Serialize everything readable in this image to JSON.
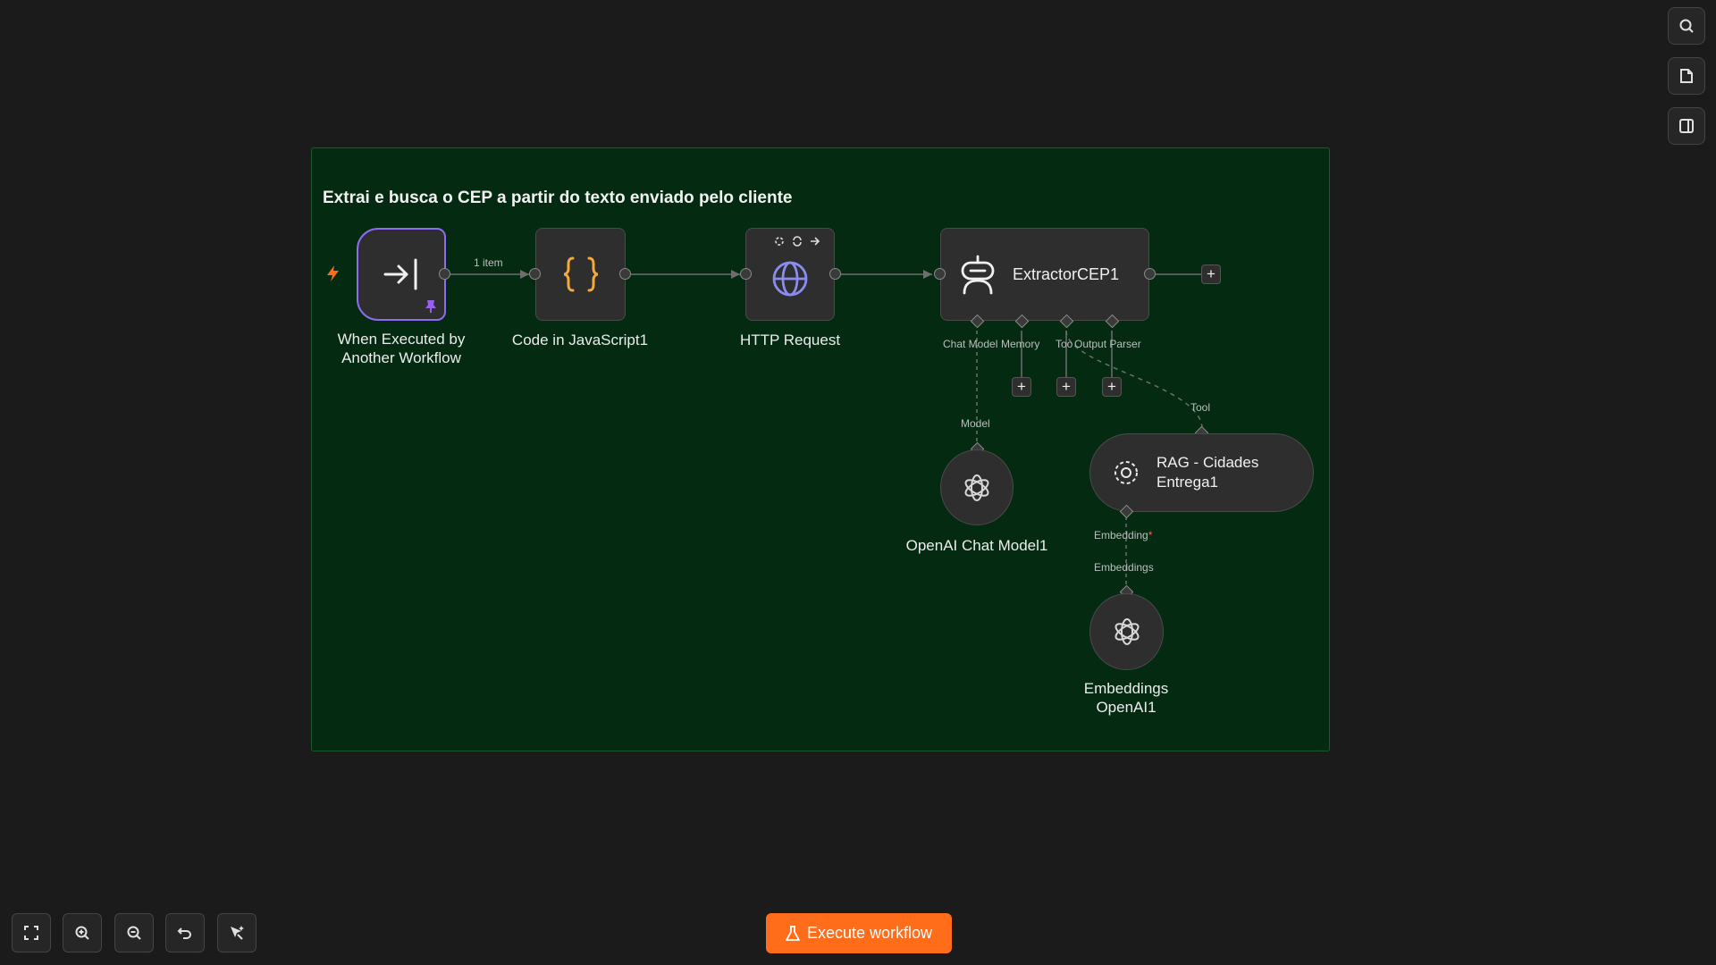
{
  "sticky_note": {
    "title": "Extrai e busca o CEP a partir do texto enviado pelo cliente"
  },
  "nodes": {
    "trigger": {
      "label_line1": "When Executed by",
      "label_line2": "Another Workflow",
      "icon": "sign-in-arrow-icon",
      "badge_icon": "pin-icon"
    },
    "code": {
      "label": "Code in JavaScript1",
      "icon": "curly-braces-icon"
    },
    "http": {
      "label": "HTTP Request",
      "icon": "globe-icon",
      "toolbar_icons": [
        "plugin-icon",
        "refresh-icon",
        "arrow-right-icon"
      ]
    },
    "agent": {
      "label": "ExtractorCEP1",
      "icon": "robot-icon"
    },
    "openai_chat": {
      "label": "OpenAI Chat Model1",
      "icon": "openai-icon"
    },
    "rag": {
      "label_line1": "RAG - Cidades",
      "label_line2": "Entrega1",
      "icon": "vector-store-icon"
    },
    "embeddings": {
      "label_line1": "Embeddings",
      "label_line2": "OpenAI1",
      "icon": "openai-icon"
    }
  },
  "connections": {
    "trigger_to_code_label": "1 item"
  },
  "agent_ports": {
    "chat_model": "Chat Model",
    "memory": "Memory",
    "tool": "Tool",
    "output_parser": "Output Parser"
  },
  "port_labels": {
    "model": "Model",
    "tool": "Tool",
    "embedding": "Embedding",
    "embedding_required": "*",
    "embeddings": "Embeddings"
  },
  "right_toolbar": {
    "icons": [
      "search-icon",
      "sticky-note-icon",
      "panel-icon"
    ]
  },
  "bottom_toolbar": {
    "icons": [
      "fit-view-icon",
      "zoom-in-icon",
      "zoom-out-icon",
      "undo-icon",
      "cleanup-icon"
    ],
    "execute_label": "Execute workflow",
    "execute_icon": "flask-icon"
  },
  "colors": {
    "accent": "#ff6d1a",
    "trigger_border": "#8b6cf2",
    "sticky_bg": "#052a12",
    "code_icon": "#f4a93a",
    "http_icon": "#8a8cf0"
  }
}
